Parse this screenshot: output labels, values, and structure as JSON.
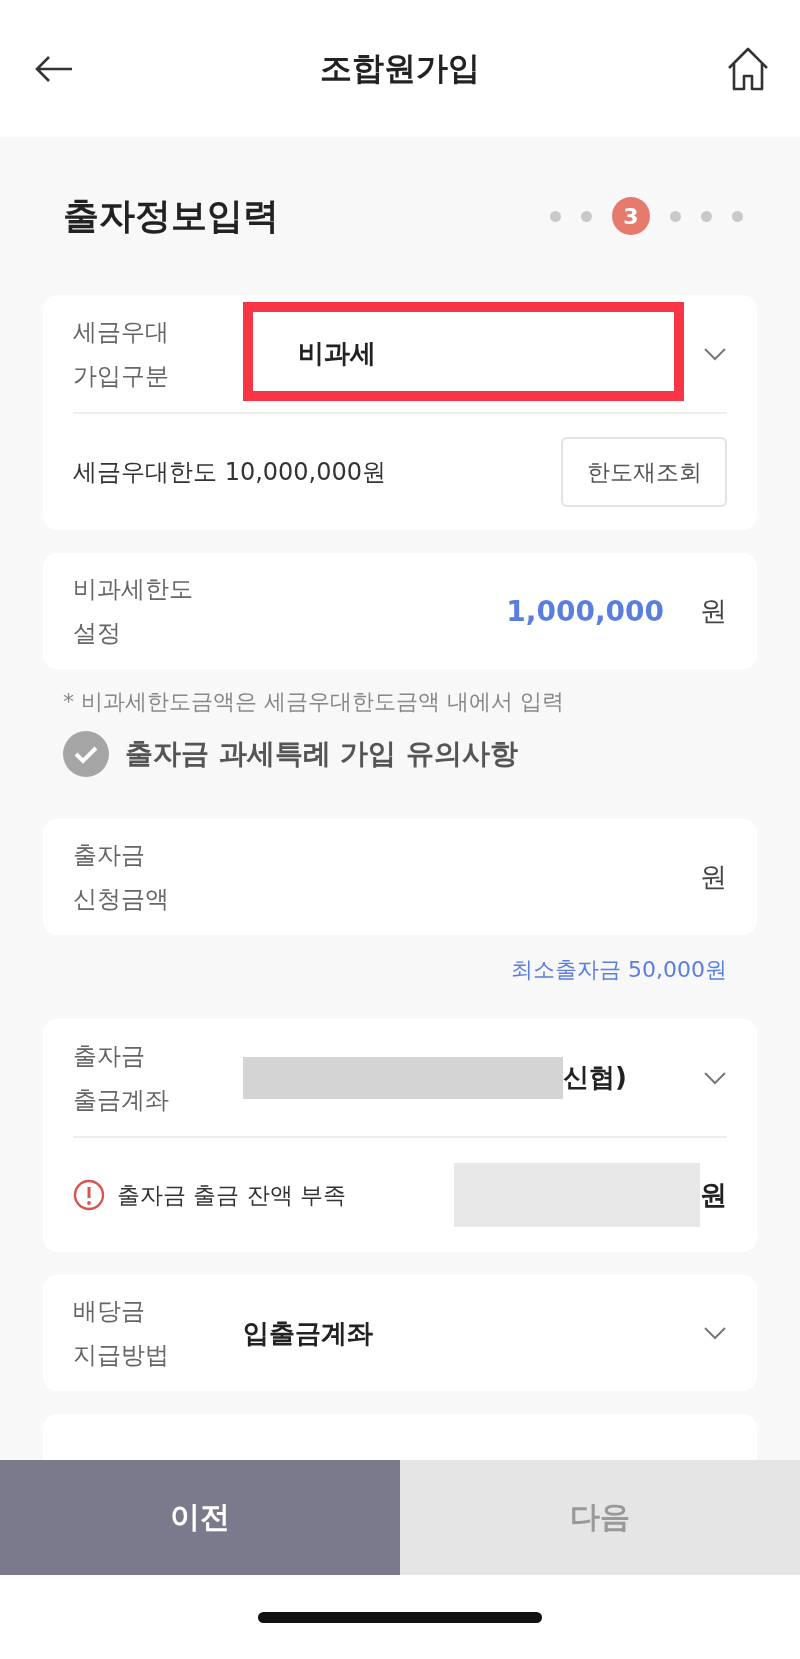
{
  "header": {
    "title": "조합원가입"
  },
  "section": {
    "title": "출자정보입력",
    "steps": [
      {
        "selected": false
      },
      {
        "selected": false
      },
      {
        "label": "3",
        "selected": true
      },
      {
        "selected": false
      },
      {
        "selected": false
      },
      {
        "selected": false
      }
    ]
  },
  "tax_card": {
    "label_lines": [
      "세금우대",
      "가입구분"
    ],
    "value": "비과세",
    "highlighted": true,
    "limit_text": "세금우대한도 10,000,000원",
    "recheck_button": "한도재조회"
  },
  "exempt_card": {
    "label_lines": [
      "비과세한도",
      "설정"
    ],
    "value": "1,000,000",
    "unit": "원"
  },
  "note": "* 비과세한도금액은 세금우대한도금액 내에서 입력",
  "notice_check": {
    "label": "출자금 과세특례 가입 유의사항",
    "checked": true
  },
  "amount_card": {
    "label_lines": [
      "출자금",
      "신청금액"
    ],
    "unit": "원"
  },
  "min_text": "최소출자금 50,000원",
  "account_card": {
    "label_lines": [
      "출자금",
      "출금계좌"
    ],
    "value_suffix": "신협)",
    "warning": "출자금 출금 잔액 부족",
    "warning_unit": "원"
  },
  "dividend_card": {
    "label_lines": [
      "배당금",
      "지급방법"
    ],
    "value": "입출금계좌"
  },
  "buttons": [
    {
      "label": "이전",
      "disabled": false
    },
    {
      "label": "다음",
      "disabled": true
    }
  ]
}
